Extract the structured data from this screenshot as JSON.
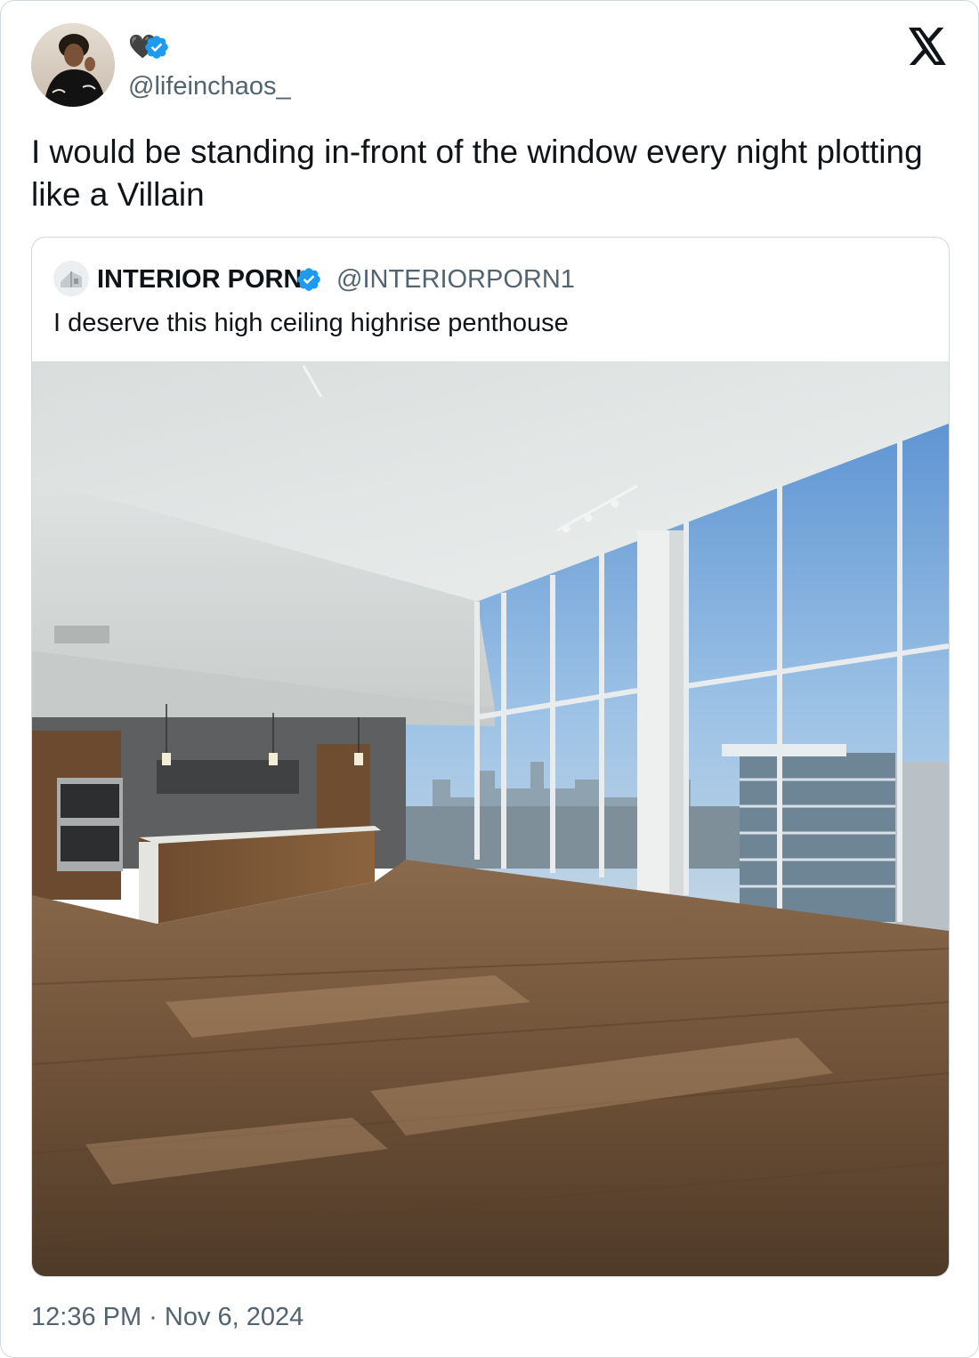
{
  "author": {
    "display_name": "🖤",
    "handle": "@lifeinchaos_",
    "verified_icon": "verified-badge-icon",
    "avatar": "profile-photo"
  },
  "tweet": {
    "text": "I would be standing in-front of the window every night plotting like a Villain",
    "timestamp": "12:36 PM · Nov 6, 2024"
  },
  "quoted_tweet": {
    "name": "INTERIOR PORN",
    "handle": "@INTERIORPORN1",
    "text": "I deserve this high ceiling highrise penthouse",
    "media": "penthouse-interior-photo"
  },
  "brand": {
    "logo": "x-logo-icon"
  },
  "colors": {
    "text_primary": "#0f1419",
    "text_secondary": "#536471",
    "border": "#cfd9de",
    "verified_blue": "#1d9bf0"
  }
}
